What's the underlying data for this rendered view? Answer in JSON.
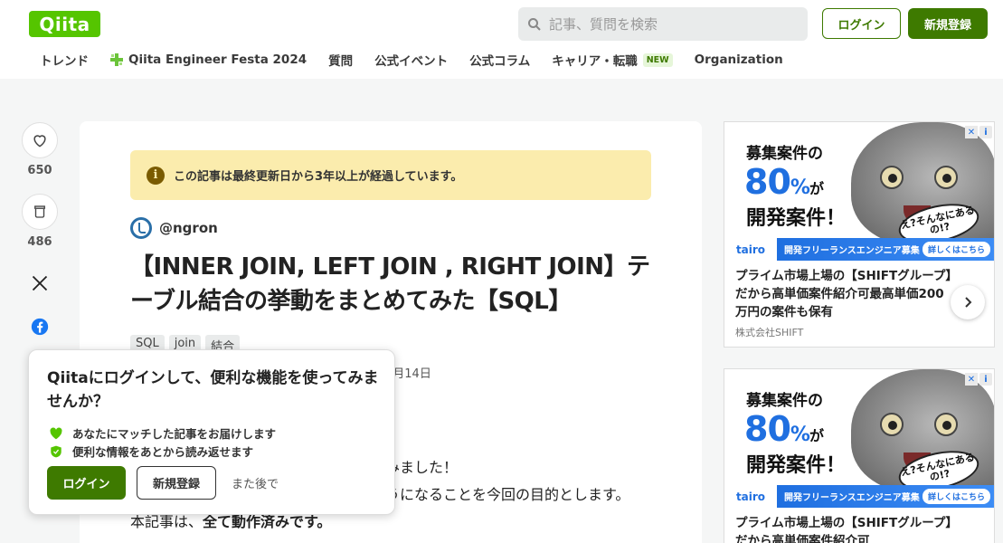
{
  "header": {
    "logo": "Qiita",
    "search_placeholder": "記事、質問を検索",
    "login": "ログイン",
    "signup": "新規登録"
  },
  "nav": {
    "items": [
      "トレンド",
      "Qiita Engineer Festa 2024",
      "質問",
      "公式イベント",
      "公式コラム",
      "キャリア・転職",
      "Organization"
    ],
    "new_badge": "NEW"
  },
  "side": {
    "like_count": "650",
    "stock_count": "486"
  },
  "article": {
    "notice": "この記事は最終更新日から3年以上が経過しています。",
    "author": "@ngron",
    "title": "【INNER JOIN, LEFT JOIN , RIGHT JOIN】テーブル結合の挙動をまとめてみた【SQL】",
    "tags": [
      "SQL",
      "join",
      "結合"
    ],
    "date_fragment": "8月14日",
    "line1_fragment": "みました！",
    "line2_fragment": "うになることを今回の目的とします。",
    "line3_prefix": "本記事は、",
    "line3_bold": "全て動作済みです。"
  },
  "popup": {
    "title": "Qiitaにログインして、便利な機能を使ってみませんか？",
    "feature1": "あなたにマッチした記事をお届けします",
    "feature2": "便利な情報をあとから読み返せます",
    "login": "ログイン",
    "signup": "新規登録",
    "later": "また後で"
  },
  "ad": {
    "headline1": "募集案件の",
    "pct": "80",
    "pct_unit": "%",
    "pct_suffix": "が",
    "headline2": "開発案件！",
    "bubble": "え?そんなにあるの!?",
    "brand": "tairo",
    "strip": "開発フリーランスエンジニア募集",
    "strip_detail": "詳しくはこちら",
    "copy": "プライム市場上場の【SHIFTグループ】だから高単価案件紹介可最高単価200万円の案件も保有",
    "company": "株式会社SHIFT",
    "copy_partial": "プライム市場上場の【SHIFTグループ】だから高単価案件紹介可"
  },
  "colors": {
    "brand_green": "#55c500",
    "dark_green": "#3e7a00",
    "notice_yellow": "#fbecad",
    "ad_blue": "#1f6fe0"
  }
}
